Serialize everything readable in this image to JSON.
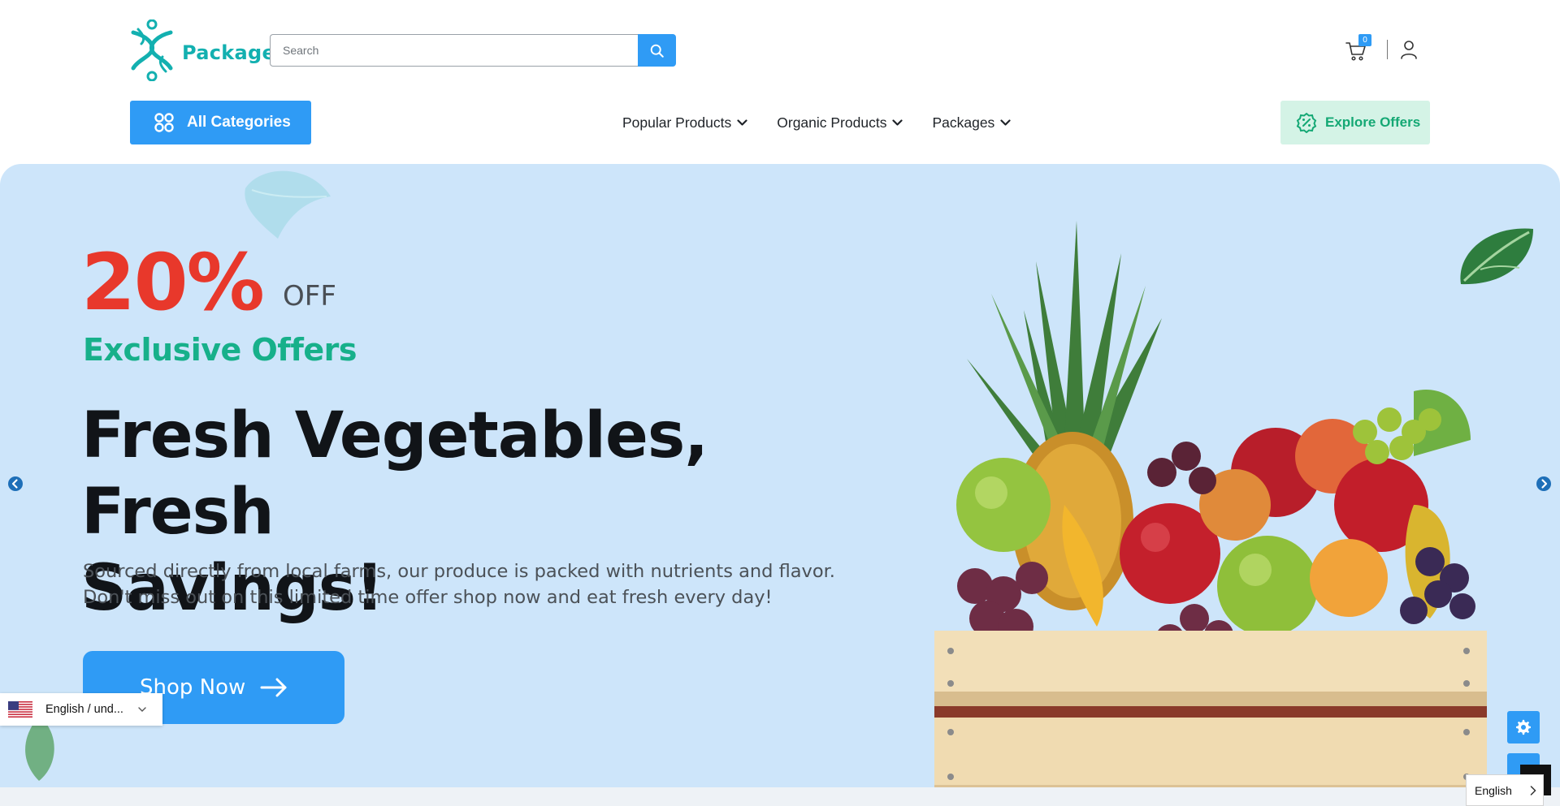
{
  "header": {
    "logo_text": "Package",
    "search": {
      "placeholder": "Search",
      "value": ""
    },
    "cart_count": "0"
  },
  "nav": {
    "all_categories": "All Categories",
    "items": [
      {
        "label": "Popular Products"
      },
      {
        "label": "Organic Products"
      },
      {
        "label": "Packages"
      }
    ],
    "explore_offers": "Explore Offers"
  },
  "hero": {
    "discount": "20%",
    "off_label": "OFF",
    "tagline": "Exclusive Offers",
    "headline_line1": "Fresh Vegetables, Fresh",
    "headline_line2": "Savings!",
    "description_line1": "Sourced directly from local farms, our produce is packed with nutrients and flavor.",
    "description_line2": "Don't miss out on this limited time offer shop now and eat fresh every day!",
    "cta": "Shop Now"
  },
  "language_switcher": {
    "label": "English / und..."
  },
  "language_select": {
    "value": "English"
  },
  "colors": {
    "brand_blue": "#2f9bf5",
    "brand_teal": "#13b0b0",
    "hero_bg": "#cde5fa",
    "discount_red": "#e8382b",
    "offer_green": "#17b08a",
    "explore_bg": "#d4f3e6"
  },
  "icons": {
    "search": "search-icon",
    "cart": "cart-icon",
    "user": "user-icon",
    "categories": "grid-icon",
    "explore": "discount-badge-icon",
    "chevron": "chevron-down-icon",
    "slider_prev": "arrow-left-circle-icon",
    "slider_next": "arrow-right-circle-icon",
    "settings": "gear-icon"
  }
}
